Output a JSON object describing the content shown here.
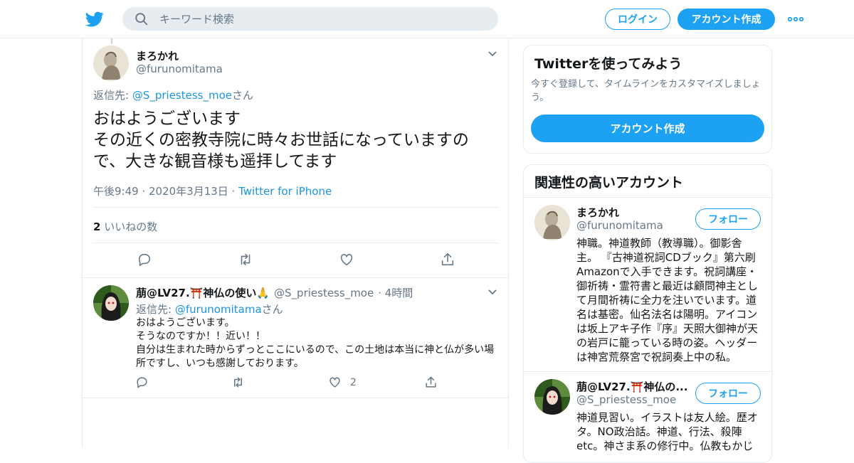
{
  "header": {
    "search_placeholder": "キーワード検索",
    "login_label": "ログイン",
    "signup_label": "アカウント作成"
  },
  "main_tweet": {
    "name": "まろかれ",
    "handle": "@furunomitama",
    "reply_prefix": "返信先: ",
    "reply_to": "@S_priestess_moe",
    "reply_suffix": "さん",
    "text": "おはようございます\nその近くの密教寺院に時々お世話になっていますので、大きな観音様も遥拝してます",
    "time": "午後9:49 · 2020年3月13日 · ",
    "source": "Twitter for iPhone",
    "likes_count": "2",
    "likes_label": " いいねの数"
  },
  "reply_tweet": {
    "name": "萠@LV27.⛩️神仏の使い🙏",
    "handle": "@S_priestess_moe",
    "time": "· 4時間",
    "reply_prefix": "返信先: ",
    "reply_to": "@furunomitama",
    "reply_suffix": "さん",
    "text": "おはようございます。\nそうなのですか！！近い！！\n自分は生まれた時からずっとここにいるので、この土地は本当に神と仏が多い場所ですし、いつも感謝しております。",
    "like_count": "2"
  },
  "sidebar": {
    "signup_title": "Twitterを使ってみよう",
    "signup_desc": "今すぐ登録して、タイムラインをカスタマイズしましょう。",
    "signup_button": "アカウント作成",
    "related_title": "関連性の高いアカウント",
    "follow_label": "フォロー",
    "accounts": [
      {
        "name": "まろかれ",
        "handle": "@furunomitama",
        "bio": "神職。神道教師（教導職）。御影舎主。 『古神道祝詞CDブック』第六刷Amazonで入手できます。祝詞講座・御祈祷・霊符書と最近は顧問神主として月間祈祷に全力を注いでいます。道名は基密。仙名法名は陽明。アイコンは坂上アキ子作『序』天照大御神が天の岩戸に籠っている時の姿。ヘッダーは神宮荒祭宮で祝詞奏上中の私。"
      },
      {
        "name": "萠@LV27.⛩️神仏の...",
        "handle": "@S_priestess_moe",
        "bio": "神道見習い。イラストは友人絵。歴オタ。NO政治話。神道、行法、殺陣etc。神さま系の修行中。仏教もかじ"
      }
    ]
  },
  "colors": {
    "accent": "#1da1f2",
    "link": "#1b95e0",
    "muted": "#657786",
    "like_red": "#e0245e"
  },
  "icons": [
    "twitter-bird-icon",
    "search-icon",
    "more-dots-icon",
    "chevron-down-icon",
    "reply-icon",
    "retweet-icon",
    "like-icon",
    "share-icon"
  ]
}
